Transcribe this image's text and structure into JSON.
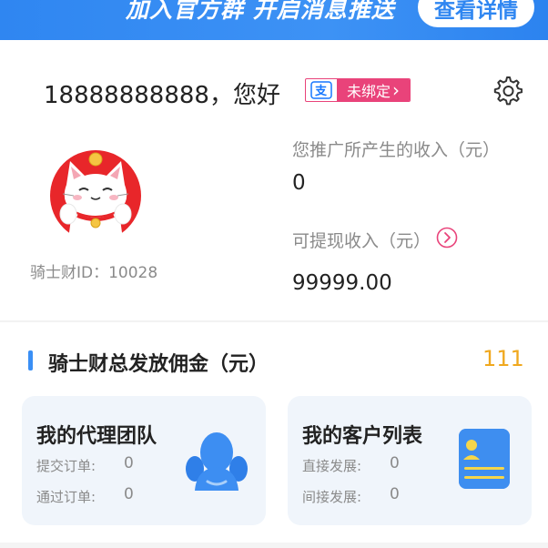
{
  "banner": {
    "text": "加入官方群 开启消息推送",
    "button_label": "查看详情"
  },
  "user": {
    "greeting": "18888888888，您好",
    "bind_status": "未绑定",
    "bind_arrow": "›",
    "bind_icon": "alipay-icon",
    "rider_id": "骑士财ID：10028"
  },
  "stats": {
    "promo_income_label": "您推广所产生的收入（元）",
    "promo_income_value": "0",
    "withdrawable_label": "可提现收入（元）",
    "withdrawable_value": "99999.00"
  },
  "commission": {
    "title": "骑士财总发放佣金（元）",
    "value": "111"
  },
  "cards": [
    {
      "title": "我的代理团队",
      "row1_label": "提交订单:",
      "row1_value": "0",
      "row2_label": "通过订单:",
      "row2_value": "0",
      "icon": "team-icon"
    },
    {
      "title": "我的客户列表",
      "row1_label": "直接发展:",
      "row1_value": "0",
      "row2_label": "间接发展:",
      "row2_value": "0",
      "icon": "contact-card-icon"
    }
  ],
  "colors": {
    "banner_blue": "#2f86f1",
    "accent_pink": "#e9437a",
    "accent_orange": "#f0a81e",
    "card_bg": "#f0f5fb"
  }
}
